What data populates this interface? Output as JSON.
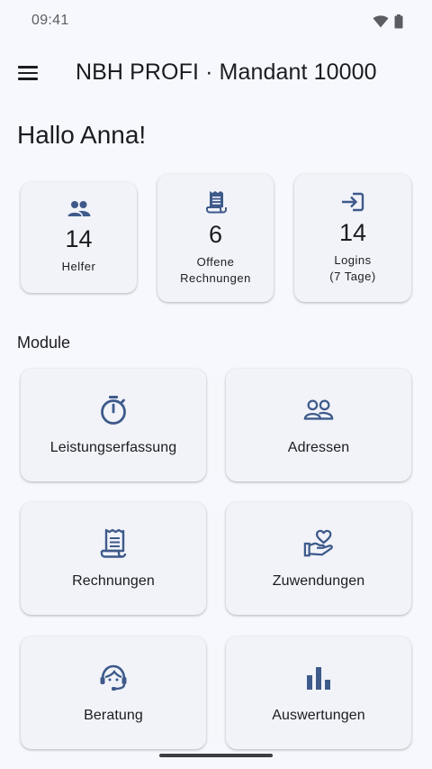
{
  "status_bar": {
    "time": "09:41"
  },
  "app_bar": {
    "title": "NBH PROFI · Mandant 10000"
  },
  "greeting": "Hallo Anna!",
  "stats": [
    {
      "icon": "people-icon",
      "value": "14",
      "label": "Helfer"
    },
    {
      "icon": "receipt-icon",
      "value": "6",
      "label": "Offene\nRechnungen"
    },
    {
      "icon": "login-icon",
      "value": "14",
      "label": "Logins\n(7 Tage)"
    }
  ],
  "modules_title": "Module",
  "modules": [
    {
      "icon": "timer-icon",
      "label": "Leistungserfassung"
    },
    {
      "icon": "group-icon",
      "label": "Adressen"
    },
    {
      "icon": "receipt-icon",
      "label": "Rechnungen"
    },
    {
      "icon": "volunteer-heart-icon",
      "label": "Zuwendungen"
    },
    {
      "icon": "support-agent-icon",
      "label": "Beratung"
    },
    {
      "icon": "bar-chart-icon",
      "label": "Auswertungen"
    }
  ],
  "colors": {
    "accent": "#3e5a8a",
    "background": "#f7f8fd",
    "card": "#f1f3f9"
  }
}
